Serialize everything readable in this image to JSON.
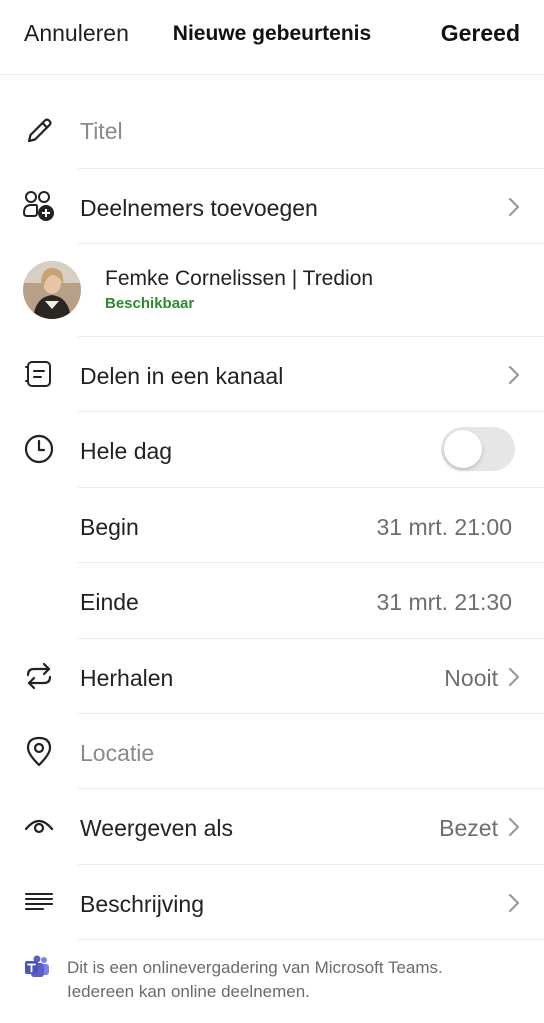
{
  "header": {
    "cancel_label": "Annuleren",
    "title": "Nieuwe gebeurtenis",
    "done_label": "Gereed"
  },
  "title_field": {
    "placeholder": "Titel",
    "icon": "pencil-icon"
  },
  "participants": {
    "label": "Deelnemers toevoegen",
    "icon": "add-people-icon"
  },
  "attendee": {
    "name": "Femke Cornelissen | Tredion",
    "status": "Beschikbaar",
    "status_color": "#2f8a2f"
  },
  "channel": {
    "label": "Delen in een kanaal",
    "icon": "channel-icon"
  },
  "all_day": {
    "label": "Hele dag",
    "enabled": false,
    "icon": "clock-icon"
  },
  "start": {
    "label": "Begin",
    "value": "31 mrt. 21:00"
  },
  "end": {
    "label": "Einde",
    "value": "31 mrt. 21:30"
  },
  "repeat": {
    "label": "Herhalen",
    "value": "Nooit",
    "icon": "repeat-icon"
  },
  "location": {
    "placeholder": "Locatie",
    "icon": "location-pin-icon"
  },
  "show_as": {
    "label": "Weergeven als",
    "value": "Bezet",
    "icon": "eye-icon"
  },
  "description": {
    "label": "Beschrijving",
    "icon": "text-lines-icon"
  },
  "footer": {
    "icon": "teams-icon",
    "text_line1": "Dit is een onlinevergadering van Microsoft Teams.",
    "text_line2": "Iedereen kan online deelnemen.",
    "teams_color": "#5b5fc7"
  }
}
